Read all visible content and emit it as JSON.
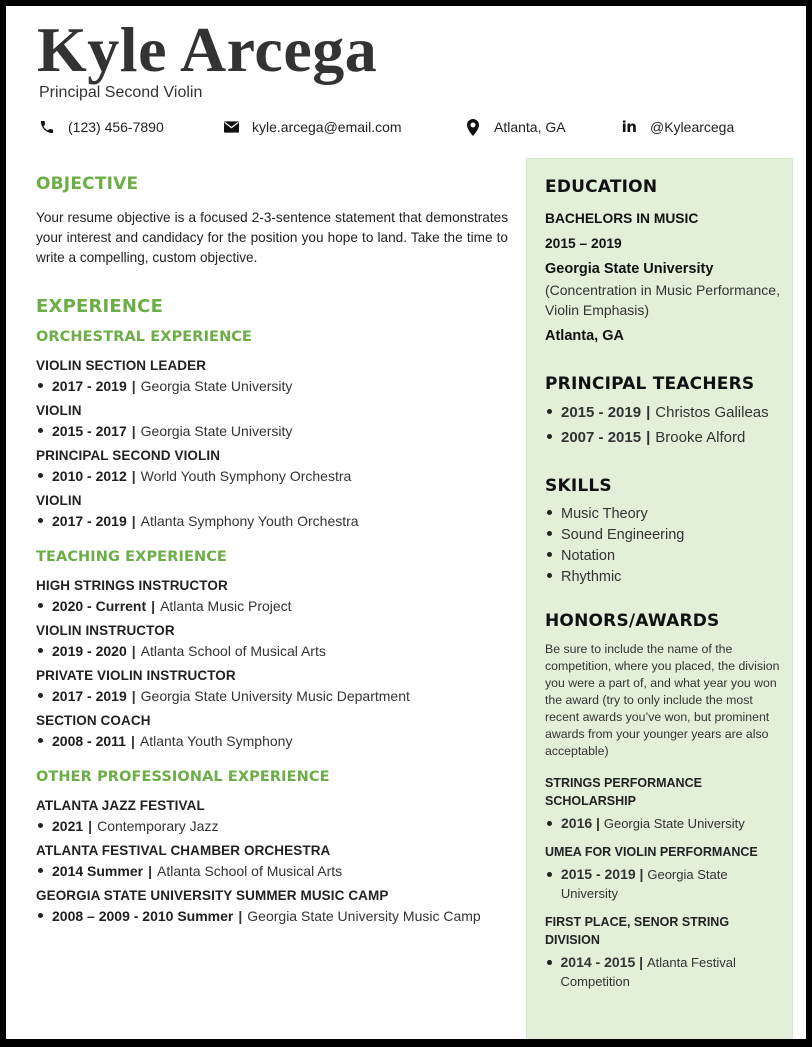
{
  "header": {
    "name": "Kyle Arcega",
    "title": "Principal Second Violin",
    "contact": {
      "phone": "(123) 456-7890",
      "email": "kyle.arcega@email.com",
      "location": "Atlanta, GA",
      "linkedin": "@Kylearcega"
    }
  },
  "theme": {
    "accent": "#6aae45",
    "sidebar_bg": "#e2efd9"
  },
  "objective": {
    "heading": "OBJECTIVE",
    "text": "Your resume objective is a focused 2-3-sentence statement that demonstrates your interest and candidacy for the position you hope to land. Take the time to write a compelling, custom objective."
  },
  "experience": {
    "heading": "EXPERIENCE",
    "groups": [
      {
        "heading": "ORCHESTRAL EXPERIENCE",
        "jobs": [
          {
            "title": "VIOLIN SECTION LEADER",
            "dates": "2017 - 2019",
            "org": "Georgia State University"
          },
          {
            "title": "VIOLIN",
            "dates": "2015 - 2017",
            "org": "Georgia State University"
          },
          {
            "title": "PRINCIPAL SECOND VIOLIN",
            "dates": "2010 - 2012",
            "org": "World Youth Symphony Orchestra"
          },
          {
            "title": "VIOLIN",
            "dates": "2017 - 2019",
            "org": "Atlanta Symphony Youth Orchestra"
          }
        ]
      },
      {
        "heading": "TEACHING EXPERIENCE",
        "jobs": [
          {
            "title": "HIGH STRINGS INSTRUCTOR",
            "dates": "2020 - Current",
            "org": "Atlanta Music Project"
          },
          {
            "title": "VIOLIN INSTRUCTOR",
            "dates": "2019 - 2020",
            "org": "Atlanta School of Musical Arts"
          },
          {
            "title": "PRIVATE VIOLIN INSTRUCTOR",
            "dates": "2017 - 2019",
            "org": "Georgia State University Music Department"
          },
          {
            "title": "SECTION COACH",
            "dates": "2008 - 2011",
            "org": "Atlanta Youth Symphony"
          }
        ]
      },
      {
        "heading": "OTHER PROFESSIONAL EXPERIENCE",
        "jobs": [
          {
            "title": "ATLANTA JAZZ FESTIVAL",
            "dates": "2021",
            "org": "Contemporary Jazz"
          },
          {
            "title": "ATLANTA FESTIVAL CHAMBER ORCHESTRA",
            "dates": "2014 Summer",
            "org": "Atlanta School of Musical Arts"
          },
          {
            "title": "GEORGIA STATE UNIVERSITY SUMMER MUSIC CAMP",
            "dates": "2008 – 2009 - 2010 Summer",
            "org": "Georgia State University Music Camp"
          }
        ]
      }
    ]
  },
  "education": {
    "heading": "EDUCATION",
    "degree": "BACHELORS IN MUSIC",
    "years": "2015 – 2019",
    "school": "Georgia State University",
    "concentration": "(Concentration in Music Performance, Violin Emphasis)",
    "location": "Atlanta, GA"
  },
  "teachers": {
    "heading": "PRINCIPAL TEACHERS",
    "items": [
      {
        "dates": "2015 - 2019",
        "name": "Christos Galileas"
      },
      {
        "dates": "2007 - 2015",
        "name": "Brooke Alford"
      }
    ]
  },
  "skills": {
    "heading": "SKILLS",
    "items": [
      "Music Theory",
      "Sound Engineering",
      "Notation",
      "Rhythmic"
    ]
  },
  "awards": {
    "heading": "HONORS/AWARDS",
    "intro": "Be sure to include the name of the competition, where you placed, the division you were a part of, and what year you won the award (try to only include the most recent awards you’ve won, but prominent awards from your younger years are also acceptable)",
    "items": [
      {
        "title": "STRINGS PERFORMANCE SCHOLARSHIP",
        "dates": "2016",
        "org": "Georgia State University"
      },
      {
        "title": "UMEA FOR VIOLIN PERFORMANCE",
        "dates": "2015 - 2019",
        "org": "Georgia State University"
      },
      {
        "title": "FIRST PLACE, SENOR STRING DIVISION",
        "dates": "2014 - 2015",
        "org": "Atlanta Festival Competition"
      }
    ]
  }
}
